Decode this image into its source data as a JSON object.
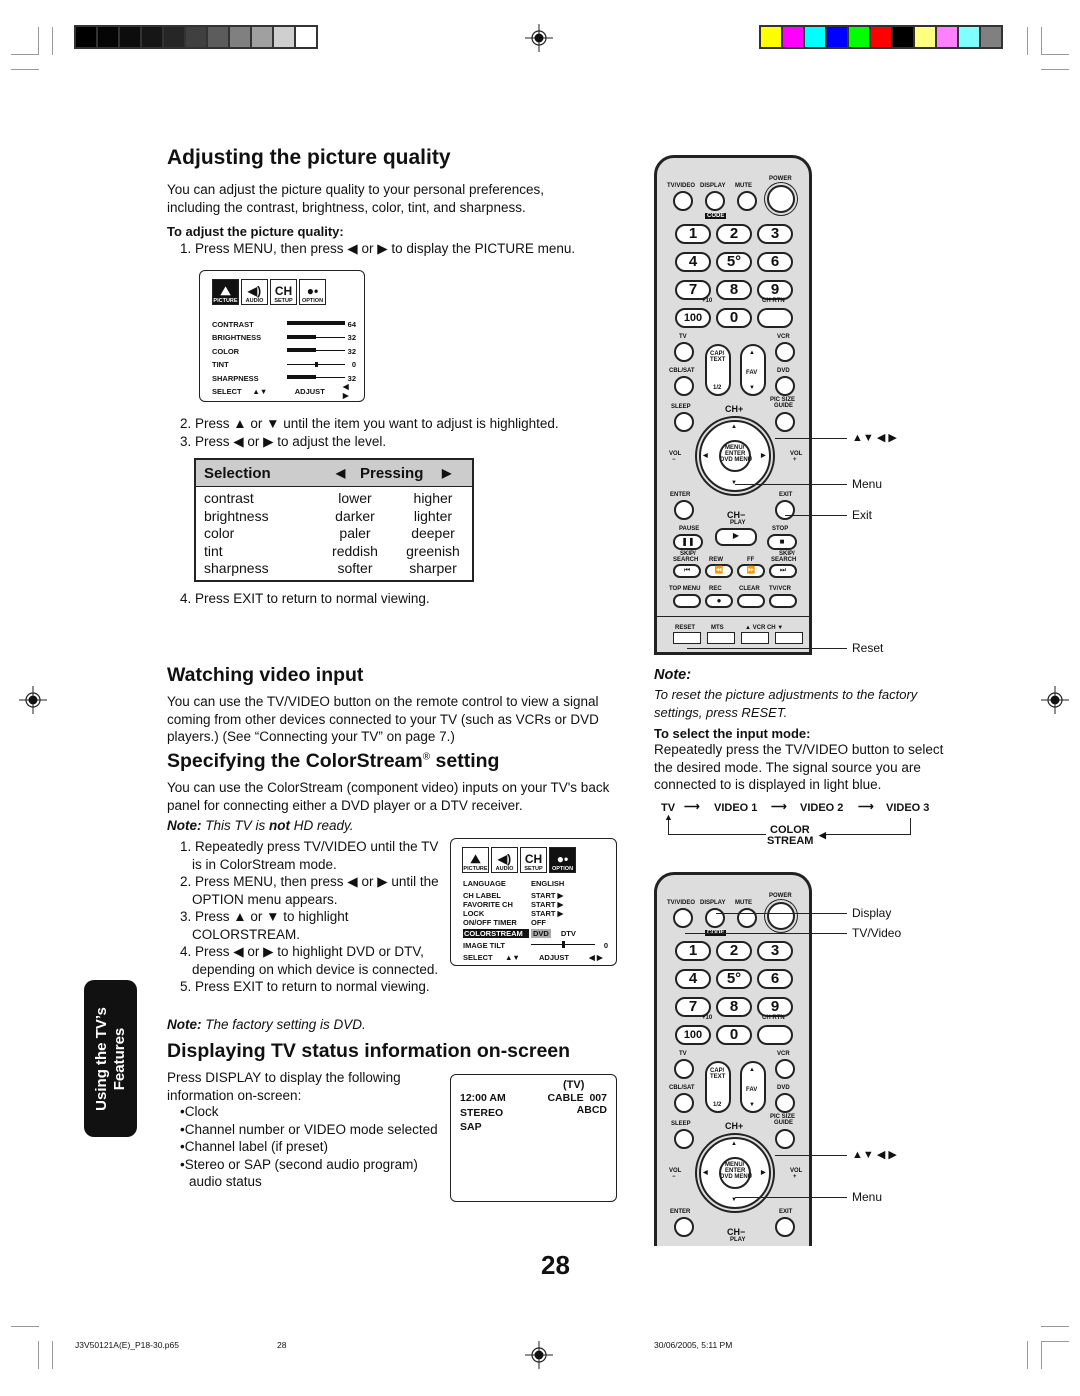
{
  "print_marks": {
    "gray_swatches": [
      "#000000",
      "#050505",
      "#0d0d0d",
      "#161616",
      "#262626",
      "#404040",
      "#5c5c5c",
      "#808080",
      "#a0a0a0",
      "#cfcfcf",
      "#ffffff"
    ],
    "color_swatches": [
      "#ffff00",
      "#ff00ff",
      "#00ffff",
      "#0000ff",
      "#00ff00",
      "#ff0000",
      "#000000",
      "#ffff80",
      "#ff80ff",
      "#80ffff",
      "#808080"
    ]
  },
  "section1": {
    "title": "Adjusting the picture quality",
    "intro": "You can adjust the picture quality to your personal preferences, including the contrast, brightness, color, tint, and sharpness.",
    "subhead": "To adjust the picture quality:",
    "step1": "1. Press MENU, then press ◀ or ▶ to display the PICTURE menu.",
    "step2": "2. Press ▲ or ▼ until the item you want to adjust is highlighted.",
    "step3": "3. Press ◀ or ▶ to adjust the level.",
    "step4": "4. Press EXIT to return to normal viewing.",
    "picture_menu": {
      "tabs": [
        {
          "label": "PICTURE",
          "icon": "picture-icon",
          "glyph": "⛰",
          "selected": true
        },
        {
          "label": "AUDIO",
          "icon": "speaker-icon",
          "glyph": "◀)",
          "selected": false
        },
        {
          "label": "SETUP",
          "icon": "ch-icon",
          "glyph": "CH",
          "selected": false
        },
        {
          "label": "OPTION",
          "icon": "people-icon",
          "glyph": "●•",
          "selected": false
        }
      ],
      "items": [
        {
          "label": "CONTRAST",
          "value": "64",
          "level": 1.0
        },
        {
          "label": "BRIGHTNESS",
          "value": "32",
          "level": 0.5
        },
        {
          "label": "COLOR",
          "value": "32",
          "level": 0.5
        },
        {
          "label": "TINT",
          "value": "0",
          "level": 0.5
        },
        {
          "label": "SHARPNESS",
          "value": "32",
          "level": 0.5
        }
      ],
      "footer_select": "SELECT",
      "footer_select_arrows": "▲▼",
      "footer_adjust": "ADJUST",
      "footer_adjust_arrows": "◀ ▶"
    },
    "table": {
      "header_selection": "Selection",
      "header_pressing": "Pressing",
      "header_left_arrow": "◀",
      "header_right_arrow": "▶",
      "rows": [
        [
          "contrast",
          "lower",
          "higher"
        ],
        [
          "brightness",
          "darker",
          "lighter"
        ],
        [
          "color",
          "paler",
          "deeper"
        ],
        [
          "tint",
          "reddish",
          "greenish"
        ],
        [
          "sharpness",
          "softer",
          "sharper"
        ]
      ]
    }
  },
  "section2": {
    "title": "Watching video input",
    "body": "You can use the TV/VIDEO button on the remote control to view a signal coming from other devices connected to your TV (such as VCRs or DVD players.) (See “Connecting your TV” on page 7.)"
  },
  "section3": {
    "title_pre": "Specifying the ColorStream",
    "title_reg": "®",
    "title_post": " setting",
    "body": "You can use the ColorStream (component video) inputs on your TV's back panel for connecting either a DVD player or a DTV receiver.",
    "note_label": "Note:",
    "note_pre": " This TV is ",
    "note_bold": "not",
    "note_post": " HD ready.",
    "steps": [
      "1. Repeatedly press TV/VIDEO until the TV is in ColorStream mode.",
      "2. Press MENU, then press ◀ or ▶ until the OPTION menu appears.",
      "3. Press ▲ or ▼ to highlight COLORSTREAM.",
      "4. Press ◀ or ▶ to highlight DVD or DTV, depending on which device is connected.",
      "5. Press EXIT to return to normal viewing."
    ],
    "note2_label": "Note:",
    "note2_text": " The factory setting is DVD.",
    "option_menu": {
      "tabs": [
        {
          "label": "PICTURE",
          "glyph": "⛰",
          "selected": false
        },
        {
          "label": "AUDIO",
          "glyph": "◀)",
          "selected": false
        },
        {
          "label": "SETUP",
          "glyph": "CH",
          "selected": false
        },
        {
          "label": "OPTION",
          "glyph": "●•",
          "selected": true
        }
      ],
      "language_label": "LANGUAGE",
      "language_value": "ENGLISH",
      "items": [
        {
          "label": "CH LABEL",
          "value": "START ▶"
        },
        {
          "label": "FAVORITE CH",
          "value": "START ▶"
        },
        {
          "label": "LOCK",
          "value": "START ▶"
        },
        {
          "label": "ON/OFF TIMER",
          "value": "OFF"
        }
      ],
      "colorstream_label": "COLORSTREAM",
      "colorstream_selected": "DVD",
      "colorstream_other": "DTV",
      "image_tilt_label": "IMAGE TILT",
      "image_tilt_value": "0",
      "image_tilt_level": 0.5,
      "footer_select": "SELECT",
      "footer_select_arrows": "▲▼",
      "footer_adjust": "ADJUST",
      "footer_adjust_arrows": "◀ ▶"
    }
  },
  "section4": {
    "title": "Displaying TV status information on-screen",
    "intro": "Press DISPLAY to display the following information on-screen:",
    "bullets": [
      "Clock",
      "Channel number or VIDEO mode selected",
      "Channel label (if preset)",
      "Stereo or SAP (second audio program) audio status"
    ],
    "status_screen": {
      "mode": "(TV)",
      "clock": "12:00 AM",
      "channel": "CABLE  007",
      "label": "ABCD",
      "audio1": "STEREO",
      "audio2": "SAP"
    }
  },
  "right_column": {
    "note_label": "Note:",
    "note_text": "To reset the picture adjustments to the factory settings, press RESET.",
    "input_mode_head": "To select the input mode:",
    "input_mode_body": "Repeatedly press the TV/VIDEO button to select the desired mode. The signal source you are connected to is displayed in light blue.",
    "flow": [
      "TV",
      "VIDEO 1",
      "VIDEO 2",
      "VIDEO 3"
    ],
    "flow_return_1": "COLOR",
    "flow_return_2": "STREAM",
    "remote1_callouts": {
      "arrows": "▲▼ ◀ ▶",
      "menu": "Menu",
      "exit": "Exit",
      "reset": "Reset"
    },
    "remote2_callouts": {
      "display": "Display",
      "tvvideo": "TV/Video",
      "arrows": "▲▼ ◀ ▶",
      "menu": "Menu"
    },
    "remote": {
      "top_labels": [
        "TV/VIDEO",
        "DISPLAY",
        "MUTE",
        "POWER"
      ],
      "code": "CODE",
      "digits": [
        "1",
        "2",
        "3",
        "4",
        "5°",
        "6",
        "7",
        "8",
        "9",
        "100",
        "0",
        ""
      ],
      "plus10": "+10",
      "chrtn": "CH RTN",
      "tv": "TV",
      "vcr": "VCR",
      "cblsat": "CBL/SAT",
      "dvd": "DVD",
      "cap1": "CAP/",
      "cap2": "TEXT",
      "half": "1/2",
      "fav": "FAV",
      "sleep": "SLEEP",
      "picsize1": "PIC SIZE",
      "picsize2": "GUIDE",
      "chplus": "CH+",
      "chminus": "CH−",
      "vol": "VOL",
      "volminus": "−",
      "volplus": "+",
      "menu1": "MENU/",
      "menu2": "ENTER",
      "menu3": "DVD MENU",
      "enter": "ENTER",
      "exit": "EXIT",
      "pause": "PAUSE",
      "play": "PLAY",
      "stop": "STOP",
      "skip": "SKIP/",
      "search": "SEARCH",
      "rew": "REW",
      "ff": "FF",
      "topmenu": "TOP MENU",
      "rec": "REC",
      "clear": "CLEAR",
      "tvvcr": "TV/VCR",
      "reset": "RESET",
      "mts": "MTS",
      "vcrch": "▲ VCR CH ▼"
    }
  },
  "side_tab": {
    "line1": "Using the TV’s",
    "line2": "Features"
  },
  "page_number": "28",
  "footer": {
    "file": "J3V50121A(E)_P18-30.p65",
    "page": "28",
    "date": "30/06/2005, 5:11 PM"
  }
}
